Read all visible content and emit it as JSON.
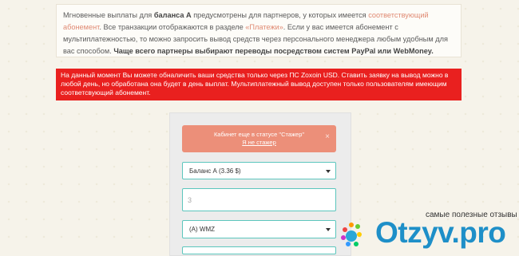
{
  "info": {
    "p1": "Мгновенные выплаты для ",
    "p1_bold": "баланса А",
    "p2": " предусмотрены для партнеров, у которых имеется ",
    "p2_link": "соответствующий абонемент",
    "p3": ". Все транзакции отображаются в разделе ",
    "p3_link": "«Платежи»",
    "p4": ". Если у вас имеется абонемент с мультиплатежностью, то можно запросить вывод средств через персонального менеджера любым удобным для вас способом. ",
    "p4_bold": "Чаще всего партнеры выбирают переводы посредством систем PayPal или WebMoney."
  },
  "alert": {
    "text": "На данный момент Вы можете обналичить ваши средства только через ПС Zoxoin USD. Ставить заявку на вывод можно в любой день, но обработана она будет в день выплат. Мультиплатежный вывод доступен только пользователям имеющим соответсвующий абонемент."
  },
  "status": {
    "line1": "Кабинет еще в статусе \"Стажер\"",
    "line2": "Я не стажер",
    "close": "×"
  },
  "form": {
    "balance_value": "Баланс А (3.36 $)",
    "amount_placeholder": "3",
    "system_value": "(A) WMZ"
  },
  "watermark": {
    "tagline": "самые полезные отзывы",
    "brand": "Otzyv.pro"
  }
}
